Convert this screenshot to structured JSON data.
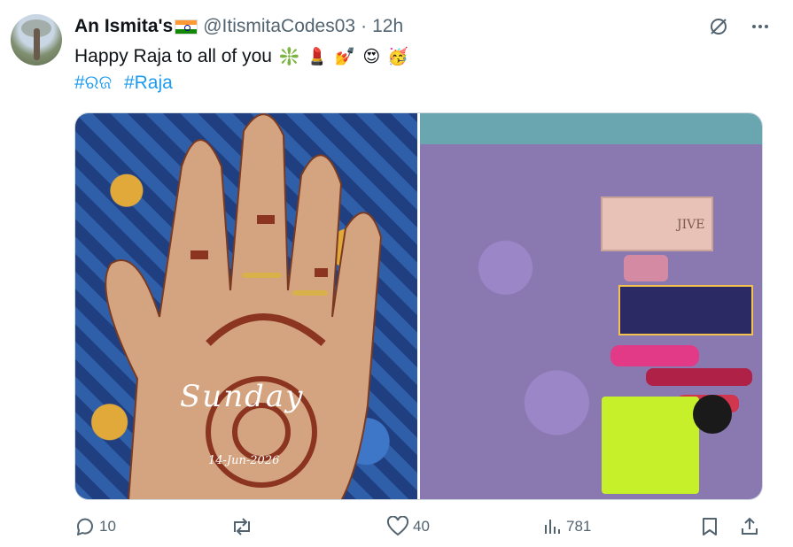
{
  "author": {
    "display_name": "An Ismita's",
    "handle": "@ItismitaCodes03",
    "separator": "·",
    "time": "12h"
  },
  "tweet": {
    "text": "Happy Raja to all of you",
    "emojis": [
      "❇️",
      "💄",
      "💅",
      "😍",
      "🥳"
    ],
    "hashtags": [
      "#ରଜ",
      "#Raja"
    ]
  },
  "media": {
    "left_photo_caption_script": "Sunday",
    "left_photo_caption_date": "14-Jun-2026",
    "right_photo_label": "JIVE"
  },
  "actions": {
    "replies": "10",
    "likes": "40",
    "views": "781"
  },
  "colors": {
    "accent": "#1d9bf0",
    "muted": "#536471",
    "text": "#0f1419"
  }
}
